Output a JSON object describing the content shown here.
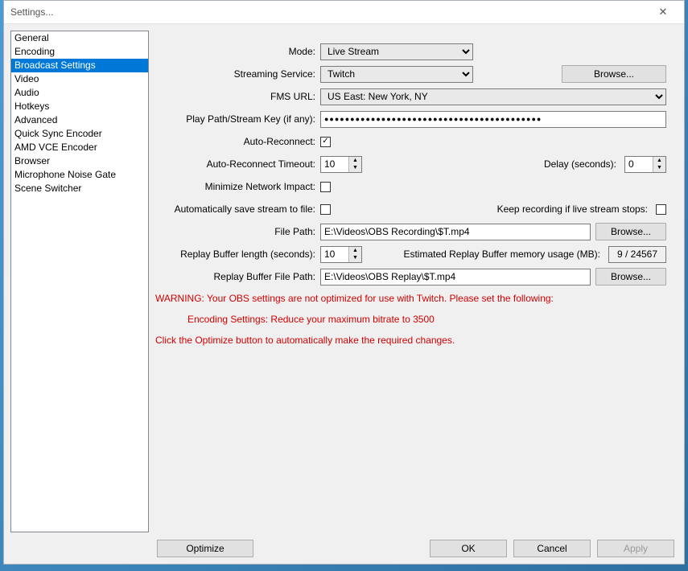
{
  "window": {
    "title": "Settings..."
  },
  "sidebar": {
    "items": [
      "General",
      "Encoding",
      "Broadcast Settings",
      "Video",
      "Audio",
      "Hotkeys",
      "Advanced",
      "Quick Sync Encoder",
      "AMD VCE Encoder",
      "Browser",
      "Microphone Noise Gate",
      "Scene Switcher"
    ],
    "selected_index": 2
  },
  "labels": {
    "mode": "Mode:",
    "streaming_service": "Streaming Service:",
    "fms_url": "FMS URL:",
    "play_path": "Play Path/Stream Key (if any):",
    "auto_reconnect": "Auto-Reconnect:",
    "auto_reconnect_timeout": "Auto-Reconnect Timeout:",
    "delay": "Delay (seconds):",
    "minimize_network_impact": "Minimize Network Impact:",
    "auto_save_stream": "Automatically save stream to file:",
    "keep_recording": "Keep recording if live stream stops:",
    "file_path": "File Path:",
    "replay_buffer_length": "Replay Buffer length (seconds):",
    "est_replay_usage": "Estimated Replay Buffer memory usage (MB):",
    "replay_file_path": "Replay Buffer File Path:"
  },
  "values": {
    "mode": "Live Stream",
    "streaming_service": "Twitch",
    "fms_url": "US East: New York, NY",
    "play_path_masked": "●●●●●●●●●●●●●●●●●●●●●●●●●●●●●●●●●●●●●●●●●●",
    "auto_reconnect_checked": true,
    "auto_reconnect_timeout": "10",
    "delay_seconds": "0",
    "minimize_network_impact_checked": false,
    "auto_save_stream_checked": false,
    "keep_recording_checked": false,
    "file_path": "E:\\Videos\\OBS Recording\\$T.mp4",
    "replay_buffer_length": "10",
    "est_replay_usage": "9 / 24567",
    "replay_file_path": "E:\\Videos\\OBS Replay\\$T.mp4"
  },
  "buttons": {
    "browse": "Browse...",
    "optimize": "Optimize",
    "ok": "OK",
    "cancel": "Cancel",
    "apply": "Apply"
  },
  "warning": {
    "line1": "WARNING: Your OBS settings are not optimized for use with Twitch. Please set the following:",
    "line2": "Encoding Settings: Reduce your maximum bitrate to 3500",
    "line3": "Click the Optimize button to automatically make the required changes."
  },
  "icons": {
    "checkmark": "✓",
    "up": "▲",
    "down": "▼",
    "close": "✕"
  }
}
